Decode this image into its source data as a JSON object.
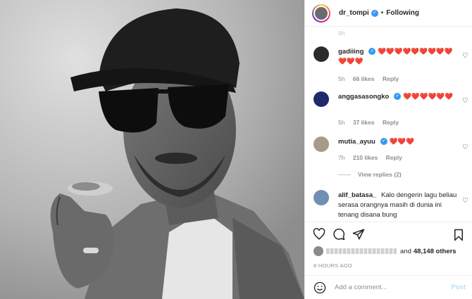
{
  "header": {
    "username": "dr_tompi",
    "follow_status": "Following",
    "separator": "•"
  },
  "comments": [
    {
      "username": "gadiiing",
      "text": "❤️❤️❤️❤️❤️❤️❤️❤️❤️❤️❤️❤️",
      "time": "5h",
      "likes": "66 likes",
      "reply": "Reply"
    },
    {
      "username": "anggasasongko",
      "text": "❤️❤️❤️❤️❤️❤️",
      "time": "5h",
      "likes": "37 likes",
      "reply": "Reply"
    },
    {
      "username": "mutia_ayuu",
      "text": "❤️❤️❤️",
      "time": "7h",
      "likes": "210 likes",
      "reply": "Reply",
      "view_replies": "View replies (2)"
    },
    {
      "username": "alif_batasa_",
      "text": "Kalo dengerin lagu beliau serasa orangnya masih di dunia ini tenang disana bung"
    }
  ],
  "faded_time": "8h",
  "likes_summary": {
    "and_label": "and",
    "count": "48,148 others"
  },
  "timestamp": "8 HOURS AGO",
  "add_comment": {
    "placeholder": "Add a comment...",
    "post_label": "Post"
  },
  "icons": {
    "like": "heart-icon",
    "comment": "comment-icon",
    "share": "share-icon",
    "save": "bookmark-icon",
    "emoji": "emoji-icon"
  },
  "colors": {
    "verified": "#3897f0",
    "post_disabled": "#b2dffc",
    "meta": "#8e8e8e"
  }
}
